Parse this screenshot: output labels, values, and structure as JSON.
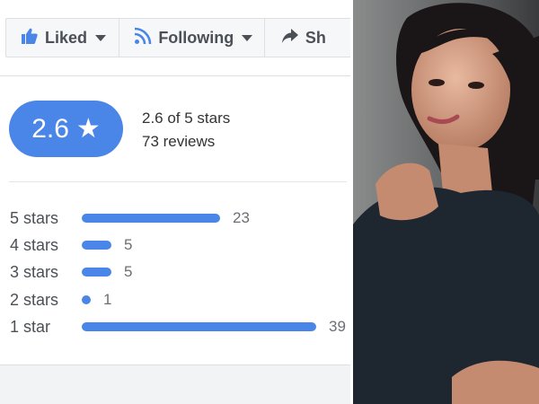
{
  "action_bar": {
    "liked_label": "Liked",
    "following_label": "Following",
    "share_label": "Sh"
  },
  "rating": {
    "score": "2.6",
    "star_glyph": "★",
    "summary": "2.6 of 5 stars",
    "reviews": "73 reviews",
    "max_count": 39
  },
  "distribution": [
    {
      "label": "5 stars",
      "count": "23",
      "value": 23
    },
    {
      "label": "4 stars",
      "count": "5",
      "value": 5
    },
    {
      "label": "3 stars",
      "count": "5",
      "value": 5
    },
    {
      "label": "2 stars",
      "count": "1",
      "value": 1
    },
    {
      "label": "1 star",
      "count": "39",
      "value": 39
    }
  ],
  "colors": {
    "accent": "#4a86e8",
    "text": "#4b4f56",
    "border": "#dddfe2"
  },
  "icons": {
    "liked": "thumbs-up-icon",
    "following": "rss-feed-icon",
    "share": "share-arrow-icon"
  }
}
